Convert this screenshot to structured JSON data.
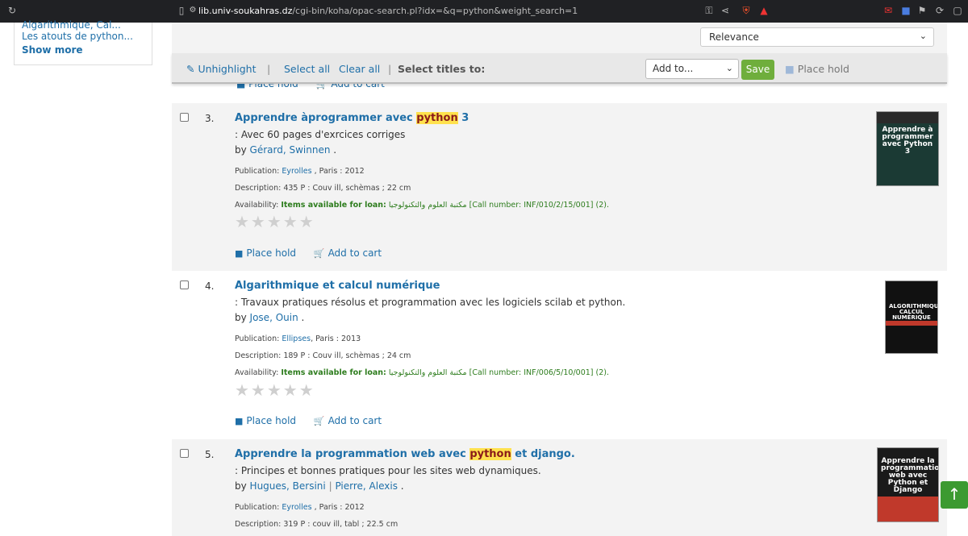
{
  "browser": {
    "url_domain": "lib.univ-soukahras.dz",
    "url_path": "/cgi-bin/koha/opac-search.pl?idx=&q=python&weight_search=1"
  },
  "sidebar": {
    "cut_item": "Algarithmique, Cal...",
    "link": "Les atouts de python...",
    "show_more": "Show more"
  },
  "sort": {
    "selected": "Relevance"
  },
  "toolbar": {
    "unhighlight": "Unhighlight",
    "select_all": "Select all",
    "clear_all": "Clear all",
    "select_titles_to": "Select titles to:",
    "add_to": "Add to...",
    "save": "Save",
    "place_hold": "Place hold"
  },
  "peek": {
    "place_hold": "Place hold",
    "add_to_cart": "Add to cart"
  },
  "results": [
    {
      "number": "3.",
      "title_pre": "Apprendre àprogrammer avec ",
      "title_hl": "python",
      "title_post": " 3",
      "subtitle": ": Avec 60 pages d'exrcices corriges",
      "by": "by",
      "author": "Gérard, Swinnen",
      "author2": "",
      "publication_label": "Publication:",
      "publisher": "Eyrolles",
      "publication_rest": " , Paris : 2012",
      "description": "Description: 435 P : Couv ill, schèmas ; 22 cm",
      "availability_label": "Availability:",
      "availability_status": "Items available for loan:",
      "library": "مكتبة العلوم والتكنولوجيا",
      "call_number": "[Call number: INF/010/2/15/001] (2).",
      "place_hold": "Place hold",
      "add_to_cart": "Add to cart"
    },
    {
      "number": "4.",
      "title_pre": "Algarithmique et calcul numérique",
      "title_hl": "",
      "title_post": "",
      "subtitle": ": Travaux pratiques résolus et programmation avec les logiciels scilab et python.",
      "by": "by",
      "author": "Jose, Ouin",
      "author2": "",
      "publication_label": "Publication:",
      "publisher": "Ellipses",
      "publication_rest": ", Paris : 2013",
      "description": "Description: 189 P : Couv ill, schèmas ; 24 cm",
      "availability_label": "Availability:",
      "availability_status": "Items available for loan:",
      "library": "مكتبة العلوم والتكنولوجيا",
      "call_number": "[Call number: INF/006/5/10/001] (2).",
      "place_hold": "Place hold",
      "add_to_cart": "Add to cart"
    },
    {
      "number": "5.",
      "title_pre": "Apprendre la programmation web avec ",
      "title_hl": "python",
      "title_post": " et django.",
      "subtitle": ": Principes et bonnes pratiques pour les sites web dynamiques.",
      "by": "by",
      "author": "Hugues, Bersini",
      "author2": "Pierre, Alexis",
      "publication_label": "Publication:",
      "publisher": "Eyrolles",
      "publication_rest": " , Paris : 2012",
      "description": "Description: 319 P : couv ill, tabl ; 22.5 cm",
      "availability_label": "",
      "availability_status": "",
      "library": "",
      "call_number": "",
      "place_hold": "",
      "add_to_cart": ""
    }
  ],
  "covers": {
    "c1": "Apprendre à programmer avec Python 3",
    "c2": "ALGORITHMIQUE CALCUL NUMÉRIQUE",
    "c3": "Apprendre la programmation web avec Python et Django"
  },
  "colors": {
    "link": "#1f6fa8",
    "highlight": "#ffe14d",
    "available": "#2e7d1e",
    "save": "#6fae3c",
    "totop": "#3c9a31"
  }
}
